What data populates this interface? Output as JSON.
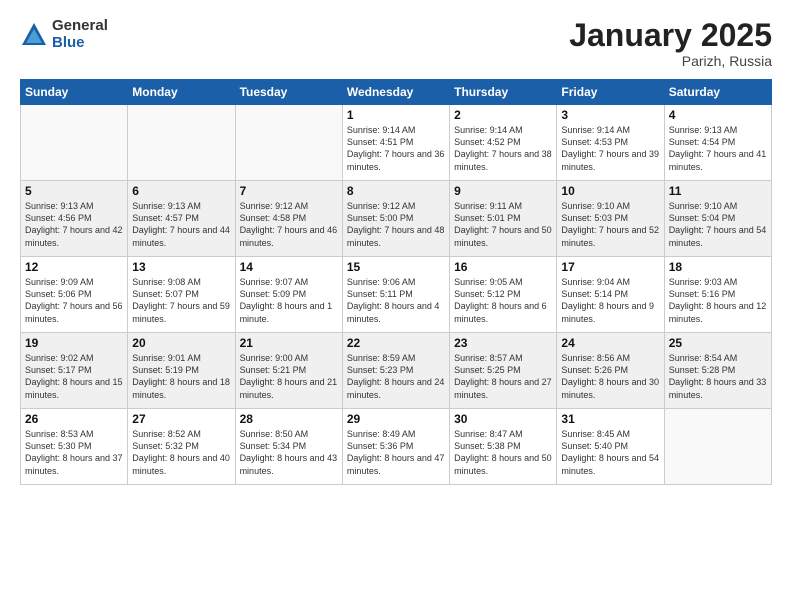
{
  "logo": {
    "general": "General",
    "blue": "Blue"
  },
  "header": {
    "month": "January 2025",
    "location": "Parizh, Russia"
  },
  "weekdays": [
    "Sunday",
    "Monday",
    "Tuesday",
    "Wednesday",
    "Thursday",
    "Friday",
    "Saturday"
  ],
  "weeks": [
    [
      {
        "day": "",
        "info": ""
      },
      {
        "day": "",
        "info": ""
      },
      {
        "day": "",
        "info": ""
      },
      {
        "day": "1",
        "info": "Sunrise: 9:14 AM\nSunset: 4:51 PM\nDaylight: 7 hours\nand 36 minutes."
      },
      {
        "day": "2",
        "info": "Sunrise: 9:14 AM\nSunset: 4:52 PM\nDaylight: 7 hours\nand 38 minutes."
      },
      {
        "day": "3",
        "info": "Sunrise: 9:14 AM\nSunset: 4:53 PM\nDaylight: 7 hours\nand 39 minutes."
      },
      {
        "day": "4",
        "info": "Sunrise: 9:13 AM\nSunset: 4:54 PM\nDaylight: 7 hours\nand 41 minutes."
      }
    ],
    [
      {
        "day": "5",
        "info": "Sunrise: 9:13 AM\nSunset: 4:56 PM\nDaylight: 7 hours\nand 42 minutes."
      },
      {
        "day": "6",
        "info": "Sunrise: 9:13 AM\nSunset: 4:57 PM\nDaylight: 7 hours\nand 44 minutes."
      },
      {
        "day": "7",
        "info": "Sunrise: 9:12 AM\nSunset: 4:58 PM\nDaylight: 7 hours\nand 46 minutes."
      },
      {
        "day": "8",
        "info": "Sunrise: 9:12 AM\nSunset: 5:00 PM\nDaylight: 7 hours\nand 48 minutes."
      },
      {
        "day": "9",
        "info": "Sunrise: 9:11 AM\nSunset: 5:01 PM\nDaylight: 7 hours\nand 50 minutes."
      },
      {
        "day": "10",
        "info": "Sunrise: 9:10 AM\nSunset: 5:03 PM\nDaylight: 7 hours\nand 52 minutes."
      },
      {
        "day": "11",
        "info": "Sunrise: 9:10 AM\nSunset: 5:04 PM\nDaylight: 7 hours\nand 54 minutes."
      }
    ],
    [
      {
        "day": "12",
        "info": "Sunrise: 9:09 AM\nSunset: 5:06 PM\nDaylight: 7 hours\nand 56 minutes."
      },
      {
        "day": "13",
        "info": "Sunrise: 9:08 AM\nSunset: 5:07 PM\nDaylight: 7 hours\nand 59 minutes."
      },
      {
        "day": "14",
        "info": "Sunrise: 9:07 AM\nSunset: 5:09 PM\nDaylight: 8 hours\nand 1 minute."
      },
      {
        "day": "15",
        "info": "Sunrise: 9:06 AM\nSunset: 5:11 PM\nDaylight: 8 hours\nand 4 minutes."
      },
      {
        "day": "16",
        "info": "Sunrise: 9:05 AM\nSunset: 5:12 PM\nDaylight: 8 hours\nand 6 minutes."
      },
      {
        "day": "17",
        "info": "Sunrise: 9:04 AM\nSunset: 5:14 PM\nDaylight: 8 hours\nand 9 minutes."
      },
      {
        "day": "18",
        "info": "Sunrise: 9:03 AM\nSunset: 5:16 PM\nDaylight: 8 hours\nand 12 minutes."
      }
    ],
    [
      {
        "day": "19",
        "info": "Sunrise: 9:02 AM\nSunset: 5:17 PM\nDaylight: 8 hours\nand 15 minutes."
      },
      {
        "day": "20",
        "info": "Sunrise: 9:01 AM\nSunset: 5:19 PM\nDaylight: 8 hours\nand 18 minutes."
      },
      {
        "day": "21",
        "info": "Sunrise: 9:00 AM\nSunset: 5:21 PM\nDaylight: 8 hours\nand 21 minutes."
      },
      {
        "day": "22",
        "info": "Sunrise: 8:59 AM\nSunset: 5:23 PM\nDaylight: 8 hours\nand 24 minutes."
      },
      {
        "day": "23",
        "info": "Sunrise: 8:57 AM\nSunset: 5:25 PM\nDaylight: 8 hours\nand 27 minutes."
      },
      {
        "day": "24",
        "info": "Sunrise: 8:56 AM\nSunset: 5:26 PM\nDaylight: 8 hours\nand 30 minutes."
      },
      {
        "day": "25",
        "info": "Sunrise: 8:54 AM\nSunset: 5:28 PM\nDaylight: 8 hours\nand 33 minutes."
      }
    ],
    [
      {
        "day": "26",
        "info": "Sunrise: 8:53 AM\nSunset: 5:30 PM\nDaylight: 8 hours\nand 37 minutes."
      },
      {
        "day": "27",
        "info": "Sunrise: 8:52 AM\nSunset: 5:32 PM\nDaylight: 8 hours\nand 40 minutes."
      },
      {
        "day": "28",
        "info": "Sunrise: 8:50 AM\nSunset: 5:34 PM\nDaylight: 8 hours\nand 43 minutes."
      },
      {
        "day": "29",
        "info": "Sunrise: 8:49 AM\nSunset: 5:36 PM\nDaylight: 8 hours\nand 47 minutes."
      },
      {
        "day": "30",
        "info": "Sunrise: 8:47 AM\nSunset: 5:38 PM\nDaylight: 8 hours\nand 50 minutes."
      },
      {
        "day": "31",
        "info": "Sunrise: 8:45 AM\nSunset: 5:40 PM\nDaylight: 8 hours\nand 54 minutes."
      },
      {
        "day": "",
        "info": ""
      }
    ]
  ]
}
